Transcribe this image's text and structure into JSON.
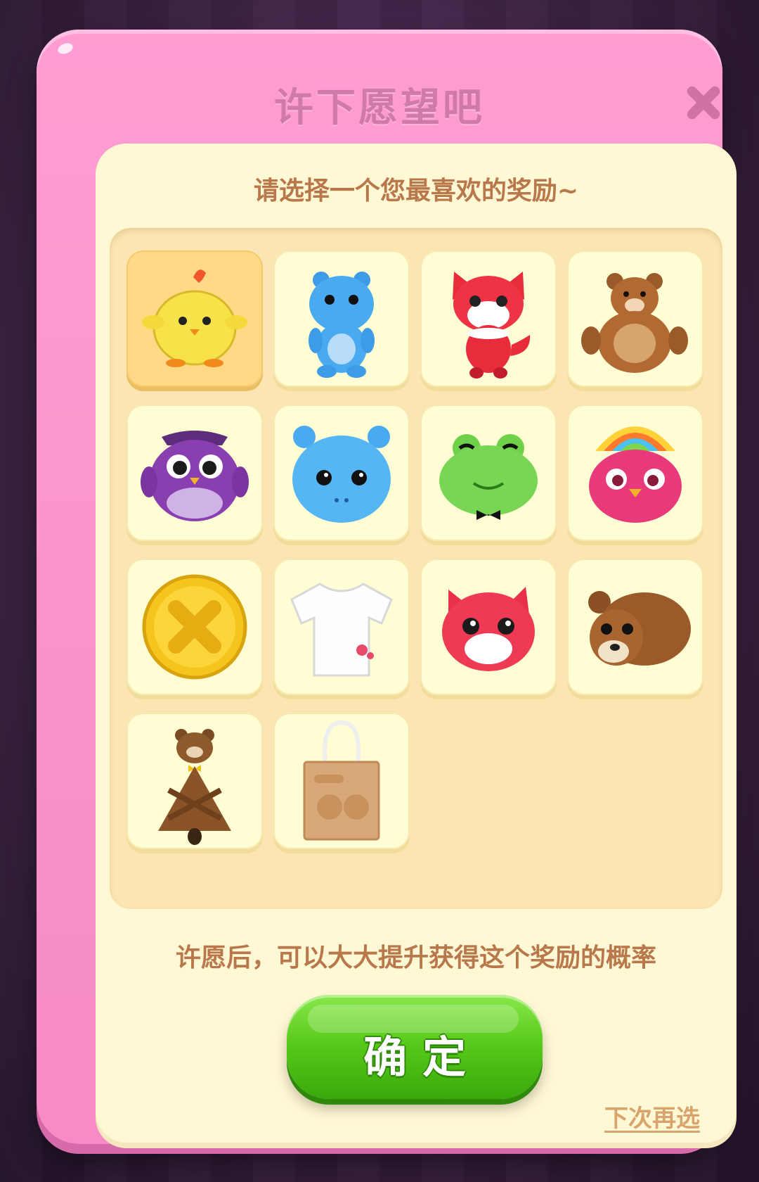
{
  "dialog": {
    "title": "许下愿望吧",
    "subtitle": "请选择一个您最喜欢的奖励~",
    "hint": "许愿后，可以大大提升获得这个奖励的概率",
    "confirm_label": "确定",
    "skip_label": "下次再选"
  },
  "rewards": [
    {
      "name": "yellow-chick-plush",
      "selected": true
    },
    {
      "name": "blue-hippo-plush",
      "selected": false
    },
    {
      "name": "red-fox-plush",
      "selected": false
    },
    {
      "name": "brown-bear-plush",
      "selected": false
    },
    {
      "name": "purple-owl-pillow",
      "selected": false
    },
    {
      "name": "blue-hippo-pillow",
      "selected": false
    },
    {
      "name": "green-frog-pillow",
      "selected": false
    },
    {
      "name": "rainbow-bird-pillow",
      "selected": false
    },
    {
      "name": "gold-coin-pillow",
      "selected": false
    },
    {
      "name": "white-t-shirt",
      "selected": false
    },
    {
      "name": "red-fox-head-pillow",
      "selected": false
    },
    {
      "name": "bear-head-pillow",
      "selected": false
    },
    {
      "name": "raccoon-blanket",
      "selected": false
    },
    {
      "name": "tote-bag",
      "selected": false
    }
  ],
  "colors": {
    "modal_pink": "#f78bc6",
    "panel_cream": "#fff8d5",
    "text_brown": "#b8784b",
    "button_green": "#57c919",
    "selected_tile": "#ffd985"
  }
}
